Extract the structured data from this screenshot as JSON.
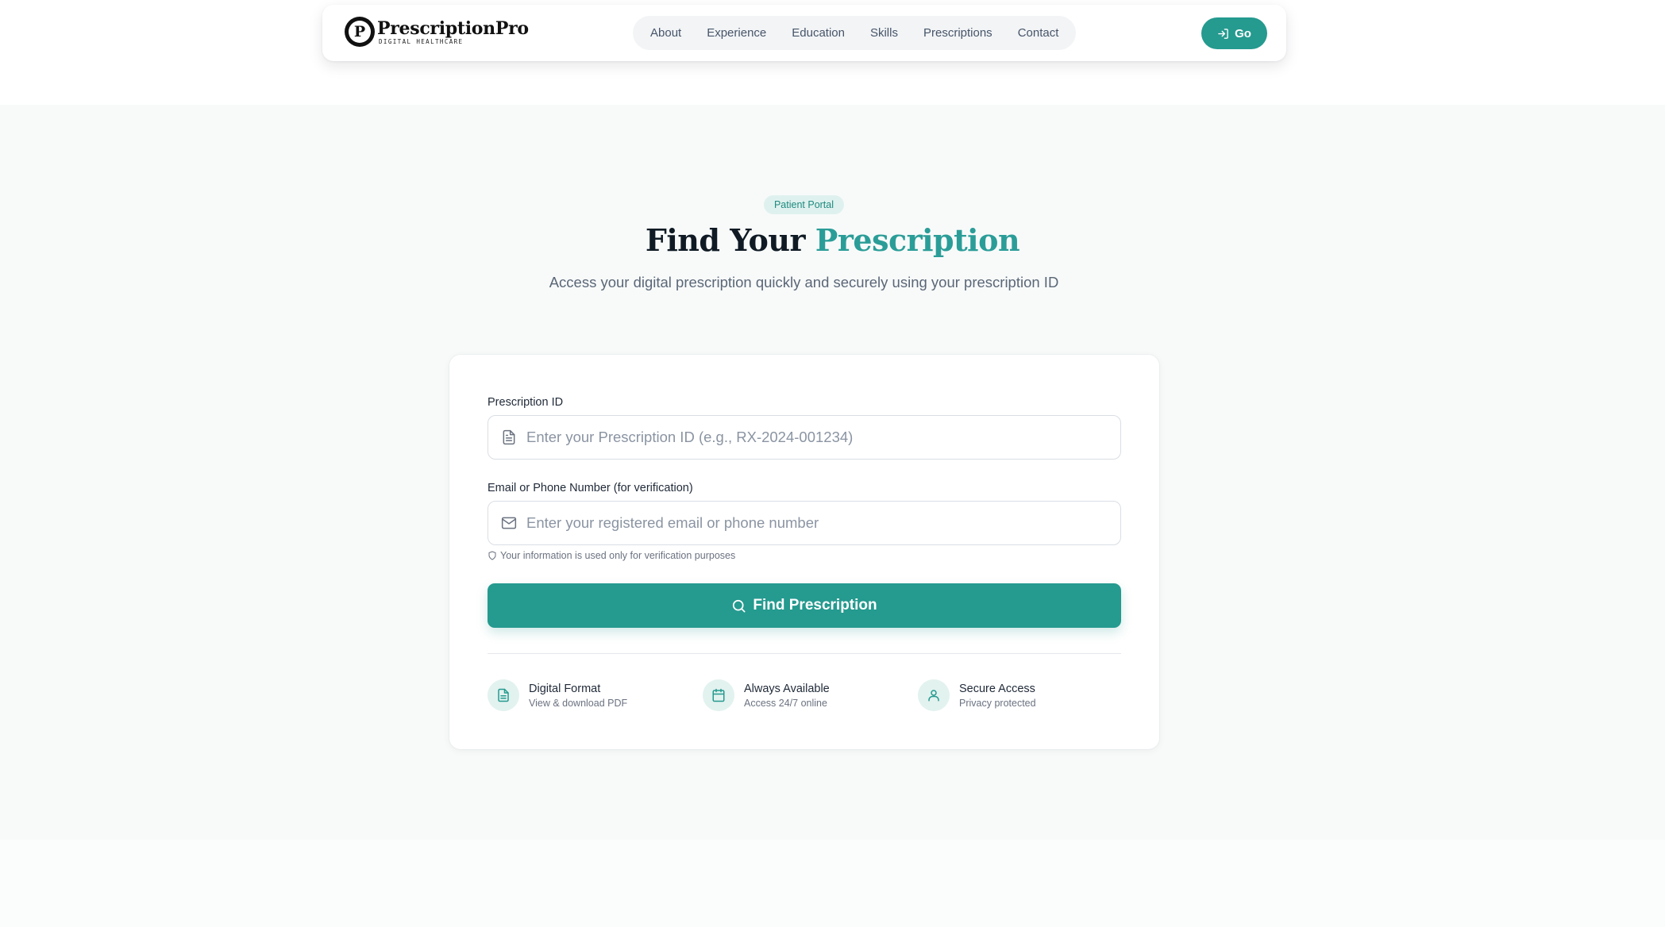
{
  "brand": {
    "logo_letter": "P",
    "name": "PrescriptionPro",
    "tagline": "DIGITAL HEALTHCARE"
  },
  "nav": {
    "items": [
      {
        "label": "About"
      },
      {
        "label": "Experience"
      },
      {
        "label": "Education"
      },
      {
        "label": "Skills"
      },
      {
        "label": "Prescriptions"
      },
      {
        "label": "Contact"
      }
    ],
    "go_label": "Go"
  },
  "hero": {
    "badge": "Patient Portal",
    "title_prefix": "Find Your",
    "title_accent": "Prescription",
    "subtitle": "Access your digital prescription quickly and securely using your prescription ID"
  },
  "form": {
    "prescription_label": "Prescription ID",
    "prescription_placeholder": "Enter your Prescription ID (e.g., RX-2024-001234)",
    "prescription_value": "",
    "contact_label": "Email or Phone Number (for verification)",
    "contact_placeholder": "Enter your registered email or phone number",
    "contact_value": "",
    "helper": "Your information is used only for verification purposes",
    "submit_label": "Find Prescription"
  },
  "features": [
    {
      "title": "Digital Format",
      "subtitle": "View & download PDF",
      "icon": "document-icon"
    },
    {
      "title": "Always Available",
      "subtitle": "Access 24/7 online",
      "icon": "calendar-icon"
    },
    {
      "title": "Secure Access",
      "subtitle": "Privacy protected",
      "icon": "user-icon"
    }
  ],
  "colors": {
    "primary": "#259a8f",
    "accent_text": "#2b9d98",
    "badge_bg": "#dff1ee",
    "section_bg": "#f8fafa"
  }
}
